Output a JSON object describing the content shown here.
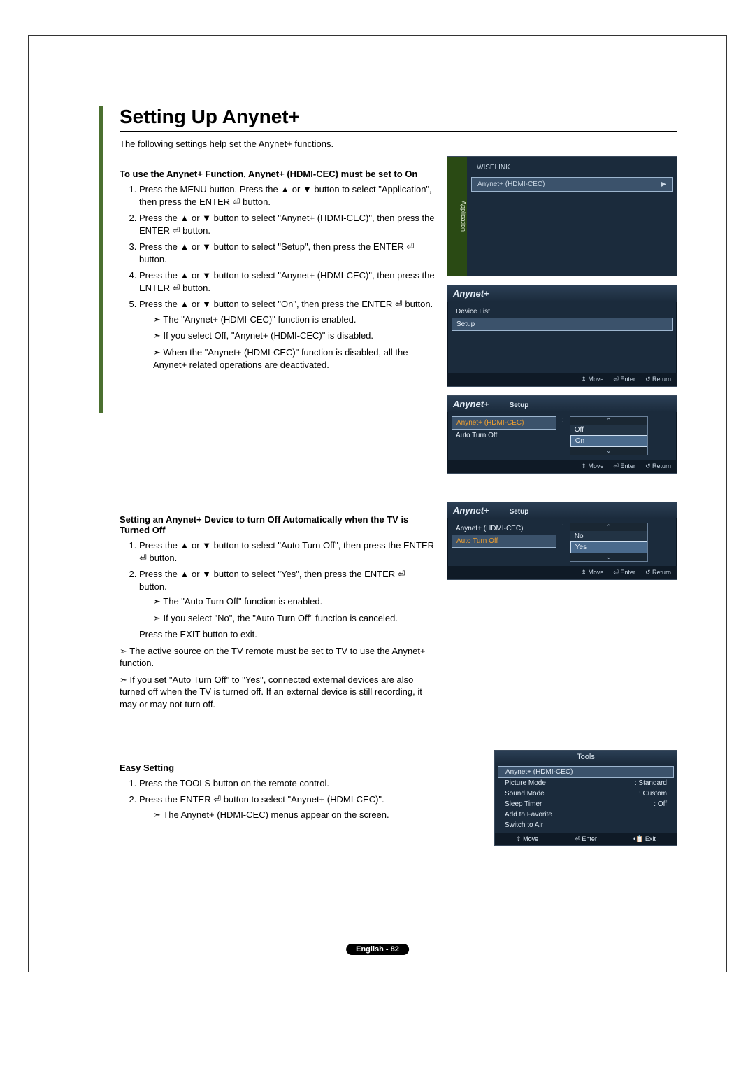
{
  "title": "Setting Up Anynet+",
  "intro": "The following settings help set the Anynet+ functions.",
  "section1": {
    "heading": "To use the Anynet+ Function, Anynet+ (HDMI-CEC) must be set to On",
    "steps": [
      "Press the MENU button. Press the ▲ or ▼ button to select \"Application\", then press the ENTER ⏎ button.",
      "Press the ▲ or ▼ button to select \"Anynet+ (HDMI-CEC)\", then press the ENTER ⏎ button.",
      "Press the ▲ or ▼ button to select \"Setup\", then press the ENTER ⏎ button.",
      "Press the ▲ or ▼ button to select \"Anynet+ (HDMI-CEC)\", then press the ENTER ⏎ button.",
      "Press the ▲ or ▼ button to select \"On\", then press the ENTER ⏎ button."
    ],
    "sub5": [
      "The \"Anynet+ (HDMI-CEC)\" function is enabled.",
      "If you select Off, \"Anynet+ (HDMI-CEC)\" is disabled.",
      "When the \"Anynet+ (HDMI-CEC)\" function is disabled, all the Anynet+ related operations are deactivated."
    ]
  },
  "section2": {
    "heading": "Setting an Anynet+ Device to turn Off Automatically when the TV is Turned Off",
    "steps": [
      "Press the ▲ or ▼ button to select \"Auto Turn Off\", then press the ENTER ⏎ button.",
      "Press the ▲ or ▼ button to select \"Yes\", then press the ENTER ⏎ button."
    ],
    "sub2": [
      "The \"Auto Turn Off\" function is enabled.",
      "If you select \"No\", the \"Auto Turn Off\" function is canceled."
    ],
    "exit_line": "Press the EXIT button to exit.",
    "notes": [
      "The active source on the TV remote must be set to TV to use the Anynet+ function.",
      "If you set \"Auto Turn Off\" to \"Yes\", connected external devices are also turned off when the TV is turned off. If an external device is still recording, it may or may not turn off."
    ]
  },
  "section3": {
    "heading": "Easy Setting",
    "steps": [
      "Press the TOOLS button on the remote control.",
      "Press the ENTER ⏎ button to select \"Anynet+ (HDMI-CEC)\"."
    ],
    "sub2": [
      "The Anynet+ (HDMI-CEC) menus appear on the screen."
    ]
  },
  "osd_app": {
    "side_label": "Application",
    "items": [
      "WISELINK",
      "Anynet+ (HDMI-CEC)"
    ],
    "arrow": "▶"
  },
  "osd_anynet_menu": {
    "brand": "Anynet+",
    "items": [
      "Device List",
      "Setup"
    ],
    "footer": [
      "⇕ Move",
      "⏎ Enter",
      "↺ Return"
    ]
  },
  "osd_setup_on": {
    "brand": "Anynet+",
    "title": "Setup",
    "row1_label": "Anynet+ (HDMI-CEC)",
    "row2_label": "Auto Turn Off",
    "options": [
      "Off",
      "On"
    ],
    "footer": [
      "⇕ Move",
      "⏎ Enter",
      "↺ Return"
    ]
  },
  "osd_setup_auto": {
    "brand": "Anynet+",
    "title": "Setup",
    "row1_label": "Anynet+ (HDMI-CEC)",
    "row2_label": "Auto Turn Off",
    "options": [
      "No",
      "Yes"
    ],
    "footer": [
      "⇕ Move",
      "⏎ Enter",
      "↺ Return"
    ]
  },
  "osd_tools": {
    "title": "Tools",
    "rows": [
      {
        "label": "Anynet+ (HDMI-CEC)",
        "value": ""
      },
      {
        "label": "Picture Mode",
        "value": "Standard"
      },
      {
        "label": "Sound Mode",
        "value": "Custom"
      },
      {
        "label": "Sleep Timer",
        "value": "Off"
      },
      {
        "label": "Add to Favorite",
        "value": ""
      },
      {
        "label": "Switch to Air",
        "value": ""
      }
    ],
    "footer": [
      "⇕ Move",
      "⏎ Enter",
      "•📋 Exit"
    ]
  },
  "page_footer": "English - 82"
}
